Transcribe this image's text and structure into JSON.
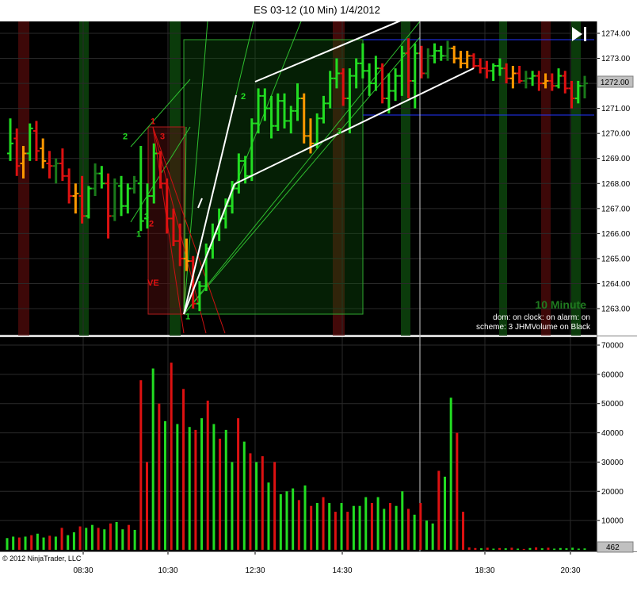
{
  "window": {
    "title": "ES 03-12 (10 Min)  1/4/2012",
    "copyright": "© 2012 NinjaTrader, LLC",
    "interval_label": "10 Minute",
    "info_lines": [
      "dom: on clock: on alarm: on",
      "scheme: 3 JHMVolume on Black"
    ],
    "current_price_badge": "1272.00",
    "current_volume_badge": "462"
  },
  "colors": {
    "background": "#000000",
    "up_bar": "#22dd22",
    "down_bar": "#dd1111",
    "neutral_bar": "#ff9900",
    "dark_up_bar": "#1a7a1a",
    "shade_green": "#0c2e0c",
    "shade_red": "#3a0a0a",
    "trend_line": "#ffffff",
    "fan_line": "#33cc33",
    "channel_line": "#2233ff"
  },
  "chart_data": [
    {
      "type": "ohlc",
      "name": "price",
      "y_ticks": [
        "1263.00",
        "1264.00",
        "1265.00",
        "1266.00",
        "1267.00",
        "1268.00",
        "1269.00",
        "1270.00",
        "1271.00",
        "1272.00",
        "1273.00",
        "1274.00"
      ],
      "ylim": [
        1262.45,
        1274.4
      ],
      "x_ticks": [
        "08:30",
        "10:30",
        "12:30",
        "14:30",
        "18:30",
        "20:30"
      ],
      "grid": true,
      "annotations": [
        {
          "text": "2",
          "x": 155,
          "y": 1269.9,
          "color": "#22dd22"
        },
        {
          "text": "1",
          "x": 190,
          "y": 1270.5,
          "color": "#dd1111"
        },
        {
          "text": "3",
          "x": 202,
          "y": 1269.9,
          "color": "#dd1111"
        },
        {
          "text": "3",
          "x": 182,
          "y": 1266.7,
          "color": "#22dd22"
        },
        {
          "text": "1",
          "x": 172,
          "y": 1266.0,
          "color": "#22dd22"
        },
        {
          "text": "2",
          "x": 188,
          "y": 1266.4,
          "color": "#dd1111"
        },
        {
          "text": "VE",
          "x": 186,
          "y": 1264.05,
          "color": "#dd1111"
        },
        {
          "text": "1",
          "x": 234,
          "y": 1262.7,
          "color": "#22dd22"
        },
        {
          "text": "2",
          "x": 304,
          "y": 1271.5,
          "color": "#22dd22"
        },
        {
          "text": "3",
          "x": 425,
          "y": 1270.1,
          "color": "#22dd22"
        }
      ],
      "bars": [
        {
          "o": 1269.2,
          "h": 1270.6,
          "l": 1268.9,
          "c": 1269.6,
          "k": "g"
        },
        {
          "o": 1269.8,
          "h": 1270.2,
          "l": 1268.3,
          "c": 1268.7,
          "k": "r"
        },
        {
          "o": 1268.8,
          "h": 1269.5,
          "l": 1268.2,
          "c": 1269.2,
          "k": "o"
        },
        {
          "o": 1269.2,
          "h": 1270.4,
          "l": 1268.9,
          "c": 1270.2,
          "k": "g"
        },
        {
          "o": 1270.1,
          "h": 1270.5,
          "l": 1268.9,
          "c": 1269.3,
          "k": "r"
        },
        {
          "o": 1269.4,
          "h": 1269.8,
          "l": 1268.6,
          "c": 1268.9,
          "k": "o"
        },
        {
          "o": 1268.8,
          "h": 1269.3,
          "l": 1268.2,
          "c": 1268.7,
          "k": "r"
        },
        {
          "o": 1268.7,
          "h": 1269.0,
          "l": 1268.0,
          "c": 1268.8,
          "k": "g"
        },
        {
          "o": 1268.8,
          "h": 1269.4,
          "l": 1268.1,
          "c": 1268.3,
          "k": "r"
        },
        {
          "o": 1268.3,
          "h": 1268.6,
          "l": 1267.2,
          "c": 1267.5,
          "k": "r"
        },
        {
          "o": 1267.5,
          "h": 1268.0,
          "l": 1266.8,
          "c": 1267.6,
          "k": "o"
        },
        {
          "o": 1267.5,
          "h": 1268.3,
          "l": 1266.4,
          "c": 1266.7,
          "k": "r"
        },
        {
          "o": 1266.7,
          "h": 1267.9,
          "l": 1266.6,
          "c": 1267.8,
          "k": "g"
        },
        {
          "o": 1267.8,
          "h": 1268.8,
          "l": 1267.5,
          "c": 1268.4,
          "k": "g"
        },
        {
          "o": 1268.4,
          "h": 1268.7,
          "l": 1267.8,
          "c": 1268.0,
          "k": "g"
        },
        {
          "o": 1268.0,
          "h": 1268.4,
          "l": 1265.8,
          "c": 1266.7,
          "k": "r"
        },
        {
          "o": 1266.7,
          "h": 1268.2,
          "l": 1266.5,
          "c": 1268.0,
          "k": "g"
        },
        {
          "o": 1267.9,
          "h": 1268.3,
          "l": 1266.7,
          "c": 1267.1,
          "k": "g"
        },
        {
          "o": 1267.1,
          "h": 1268.0,
          "l": 1266.8,
          "c": 1267.8,
          "k": "g"
        },
        {
          "o": 1267.8,
          "h": 1268.3,
          "l": 1267.6,
          "c": 1268.1,
          "k": "g"
        },
        {
          "o": 1268.0,
          "h": 1269.5,
          "l": 1266.1,
          "c": 1266.5,
          "k": "g"
        },
        {
          "o": 1266.6,
          "h": 1268.0,
          "l": 1266.2,
          "c": 1267.5,
          "k": "g"
        },
        {
          "o": 1267.5,
          "h": 1269.6,
          "l": 1267.2,
          "c": 1269.2,
          "k": "g"
        },
        {
          "o": 1269.2,
          "h": 1269.3,
          "l": 1267.8,
          "c": 1268.0,
          "k": "r"
        },
        {
          "o": 1268.0,
          "h": 1268.2,
          "l": 1266.0,
          "c": 1266.6,
          "k": "r"
        },
        {
          "o": 1266.6,
          "h": 1267.0,
          "l": 1265.5,
          "c": 1265.7,
          "k": "r"
        },
        {
          "o": 1265.7,
          "h": 1266.4,
          "l": 1264.7,
          "c": 1265.0,
          "k": "r"
        },
        {
          "o": 1265.0,
          "h": 1265.8,
          "l": 1264.5,
          "c": 1264.9,
          "k": "o"
        },
        {
          "o": 1264.9,
          "h": 1265.1,
          "l": 1263.0,
          "c": 1263.2,
          "k": "r"
        },
        {
          "o": 1263.2,
          "h": 1264.1,
          "l": 1262.9,
          "c": 1263.9,
          "k": "g"
        },
        {
          "o": 1263.9,
          "h": 1265.6,
          "l": 1263.7,
          "c": 1265.4,
          "k": "g"
        },
        {
          "o": 1265.4,
          "h": 1266.4,
          "l": 1265.0,
          "c": 1266.0,
          "k": "g"
        },
        {
          "o": 1266.0,
          "h": 1267.0,
          "l": 1265.7,
          "c": 1266.6,
          "k": "g"
        },
        {
          "o": 1266.6,
          "h": 1267.4,
          "l": 1266.2,
          "c": 1267.1,
          "k": "g"
        },
        {
          "o": 1267.1,
          "h": 1268.1,
          "l": 1266.8,
          "c": 1267.8,
          "k": "g"
        },
        {
          "o": 1267.8,
          "h": 1269.2,
          "l": 1267.6,
          "c": 1268.9,
          "k": "g"
        },
        {
          "o": 1268.9,
          "h": 1269.1,
          "l": 1268.0,
          "c": 1268.3,
          "k": "g"
        },
        {
          "o": 1268.3,
          "h": 1270.6,
          "l": 1268.1,
          "c": 1270.4,
          "k": "g"
        },
        {
          "o": 1270.4,
          "h": 1271.8,
          "l": 1270.0,
          "c": 1271.5,
          "k": "g"
        },
        {
          "o": 1271.5,
          "h": 1271.8,
          "l": 1270.5,
          "c": 1271.0,
          "k": "g"
        },
        {
          "o": 1271.0,
          "h": 1271.5,
          "l": 1269.8,
          "c": 1270.3,
          "k": "g"
        },
        {
          "o": 1270.3,
          "h": 1271.6,
          "l": 1270.1,
          "c": 1271.3,
          "k": "g"
        },
        {
          "o": 1271.3,
          "h": 1271.6,
          "l": 1270.2,
          "c": 1270.5,
          "k": "g"
        },
        {
          "o": 1270.5,
          "h": 1271.1,
          "l": 1270.0,
          "c": 1270.9,
          "k": "g"
        },
        {
          "o": 1270.9,
          "h": 1272.0,
          "l": 1270.5,
          "c": 1271.4,
          "k": "g"
        },
        {
          "o": 1271.4,
          "h": 1271.6,
          "l": 1269.6,
          "c": 1269.9,
          "k": "o"
        },
        {
          "o": 1269.9,
          "h": 1270.6,
          "l": 1269.2,
          "c": 1269.6,
          "k": "o"
        },
        {
          "o": 1269.6,
          "h": 1270.8,
          "l": 1269.4,
          "c": 1270.6,
          "k": "g"
        },
        {
          "o": 1270.6,
          "h": 1271.5,
          "l": 1270.4,
          "c": 1271.2,
          "k": "g"
        },
        {
          "o": 1271.2,
          "h": 1272.5,
          "l": 1271.0,
          "c": 1272.2,
          "k": "g"
        },
        {
          "o": 1272.2,
          "h": 1273.0,
          "l": 1271.8,
          "c": 1272.4,
          "k": "g"
        },
        {
          "o": 1272.4,
          "h": 1272.6,
          "l": 1271.1,
          "c": 1271.4,
          "k": "r"
        },
        {
          "o": 1271.4,
          "h": 1272.6,
          "l": 1270.0,
          "c": 1272.3,
          "k": "g"
        },
        {
          "o": 1272.3,
          "h": 1273.0,
          "l": 1271.8,
          "c": 1272.8,
          "k": "g"
        },
        {
          "o": 1272.8,
          "h": 1273.6,
          "l": 1272.2,
          "c": 1272.5,
          "k": "g"
        },
        {
          "o": 1272.5,
          "h": 1272.8,
          "l": 1271.5,
          "c": 1272.0,
          "k": "g"
        },
        {
          "o": 1272.0,
          "h": 1273.1,
          "l": 1271.7,
          "c": 1272.6,
          "k": "g"
        },
        {
          "o": 1272.6,
          "h": 1272.8,
          "l": 1271.2,
          "c": 1271.4,
          "k": "r"
        },
        {
          "o": 1271.4,
          "h": 1272.4,
          "l": 1270.8,
          "c": 1271.7,
          "k": "g"
        },
        {
          "o": 1271.7,
          "h": 1272.6,
          "l": 1271.3,
          "c": 1272.3,
          "k": "g"
        },
        {
          "o": 1272.3,
          "h": 1273.5,
          "l": 1271.5,
          "c": 1273.2,
          "k": "g"
        },
        {
          "o": 1273.2,
          "h": 1273.8,
          "l": 1271.4,
          "c": 1272.1,
          "k": "r"
        },
        {
          "o": 1272.1,
          "h": 1273.6,
          "l": 1271.0,
          "c": 1273.2,
          "k": "g"
        },
        {
          "o": 1273.2,
          "h": 1273.5,
          "l": 1272.2,
          "c": 1272.4,
          "k": "r"
        },
        {
          "o": 1272.4,
          "h": 1273.4,
          "l": 1272.2,
          "c": 1273.1,
          "k": "g"
        },
        {
          "o": 1273.1,
          "h": 1273.6,
          "l": 1272.8,
          "c": 1273.3,
          "k": "g"
        },
        {
          "o": 1273.3,
          "h": 1273.5,
          "l": 1272.9,
          "c": 1273.1,
          "k": "g"
        },
        {
          "o": 1273.1,
          "h": 1273.7,
          "l": 1272.9,
          "c": 1273.4,
          "k": "g"
        },
        {
          "o": 1273.4,
          "h": 1273.5,
          "l": 1272.8,
          "c": 1273.0,
          "k": "o"
        },
        {
          "o": 1273.0,
          "h": 1273.3,
          "l": 1272.6,
          "c": 1272.8,
          "k": "o"
        },
        {
          "o": 1272.8,
          "h": 1273.3,
          "l": 1272.6,
          "c": 1273.1,
          "k": "o"
        },
        {
          "o": 1273.1,
          "h": 1273.2,
          "l": 1272.6,
          "c": 1272.7,
          "k": "r"
        },
        {
          "o": 1272.7,
          "h": 1273.0,
          "l": 1272.4,
          "c": 1272.6,
          "k": "r"
        },
        {
          "o": 1272.6,
          "h": 1272.9,
          "l": 1272.2,
          "c": 1272.5,
          "k": "r"
        },
        {
          "o": 1272.5,
          "h": 1272.8,
          "l": 1272.1,
          "c": 1272.7,
          "k": "g"
        },
        {
          "o": 1272.7,
          "h": 1273.0,
          "l": 1272.3,
          "c": 1272.6,
          "k": "g"
        },
        {
          "o": 1272.6,
          "h": 1272.8,
          "l": 1272.0,
          "c": 1272.2,
          "k": "r"
        },
        {
          "o": 1272.2,
          "h": 1272.7,
          "l": 1271.8,
          "c": 1272.4,
          "k": "o"
        },
        {
          "o": 1272.4,
          "h": 1272.7,
          "l": 1272.0,
          "c": 1272.1,
          "k": "r"
        },
        {
          "o": 1272.1,
          "h": 1272.5,
          "l": 1271.8,
          "c": 1272.2,
          "k": "g"
        },
        {
          "o": 1272.2,
          "h": 1272.5,
          "l": 1271.9,
          "c": 1272.3,
          "k": "g"
        },
        {
          "o": 1272.3,
          "h": 1272.5,
          "l": 1271.7,
          "c": 1272.0,
          "k": "r"
        },
        {
          "o": 1272.0,
          "h": 1272.4,
          "l": 1271.8,
          "c": 1272.1,
          "k": "o"
        },
        {
          "o": 1272.1,
          "h": 1272.4,
          "l": 1271.7,
          "c": 1271.9,
          "k": "r"
        },
        {
          "o": 1271.9,
          "h": 1272.6,
          "l": 1271.8,
          "c": 1272.3,
          "k": "g"
        },
        {
          "o": 1272.3,
          "h": 1272.5,
          "l": 1271.6,
          "c": 1271.8,
          "k": "r"
        },
        {
          "o": 1271.8,
          "h": 1272.1,
          "l": 1271.0,
          "c": 1271.4,
          "k": "r"
        },
        {
          "o": 1271.4,
          "h": 1272.1,
          "l": 1271.2,
          "c": 1271.9,
          "k": "g"
        },
        {
          "o": 1271.9,
          "h": 1272.3,
          "l": 1271.4,
          "c": 1272.0,
          "k": "g"
        }
      ]
    },
    {
      "type": "bar",
      "name": "volume",
      "y_ticks": [
        "10000",
        "20000",
        "30000",
        "40000",
        "50000",
        "60000",
        "70000"
      ],
      "ylim": [
        0,
        72000
      ],
      "x_ticks": [
        "08:30",
        "10:30",
        "12:30",
        "14:30",
        "18:30",
        "20:30"
      ],
      "grid": true,
      "values": [
        4000,
        4500,
        4200,
        4500,
        5000,
        5500,
        4200,
        4800,
        4500,
        7500,
        5000,
        6000,
        8000,
        7500,
        8500,
        7500,
        7000,
        9000,
        9500,
        7000,
        8500,
        6800,
        58000,
        30000,
        62000,
        50000,
        44000,
        64000,
        43000,
        55000,
        42000,
        41000,
        45000,
        51000,
        43000,
        38000,
        41000,
        30000,
        45000,
        37000,
        33000,
        30000,
        32000,
        23000,
        30000,
        19000,
        20000,
        21000,
        17000,
        22000,
        15000,
        16000,
        18000,
        16000,
        13000,
        16000,
        13000,
        15000,
        15000,
        18000,
        16000,
        18000,
        14000,
        16000,
        15000,
        20000,
        14000,
        12000,
        16000,
        10000,
        9000,
        27000,
        25000,
        52000,
        40000,
        13000,
        800,
        600,
        500,
        700,
        400,
        600,
        500,
        700,
        400,
        300,
        600,
        800,
        500,
        700,
        400,
        600,
        500,
        700,
        400,
        462
      ],
      "colors": "ggrgrggrgrggrggrgrggrgrrgrgrgrgrgrgrggrgrgrgrgggrgrgrgrgrgggrggrggrgrggrggrrrrgrgrgrgrgrgrgg"
    }
  ],
  "overlays": {
    "bg_shades": [
      {
        "x": 23,
        "w": 14,
        "c": "r",
        "a": 0.5
      },
      {
        "x": 100,
        "w": 12,
        "c": "g"
      },
      {
        "x": 214,
        "w": 14,
        "c": "g"
      },
      {
        "x": 420,
        "w": 15,
        "c": "r",
        "a": 0.55
      },
      {
        "x": 506,
        "w": 12,
        "c": "g"
      },
      {
        "x": 630,
        "w": 10,
        "c": "g"
      },
      {
        "x": 683,
        "w": 12,
        "c": "r",
        "a": 0.5
      },
      {
        "x": 721,
        "w": 12,
        "c": "g"
      }
    ],
    "red_box": {
      "x": 187,
      "y": 160,
      "w": 46,
      "h": 236
    },
    "green_box": {
      "x": 232,
      "y": 50,
      "w": 226,
      "h": 346
    }
  }
}
